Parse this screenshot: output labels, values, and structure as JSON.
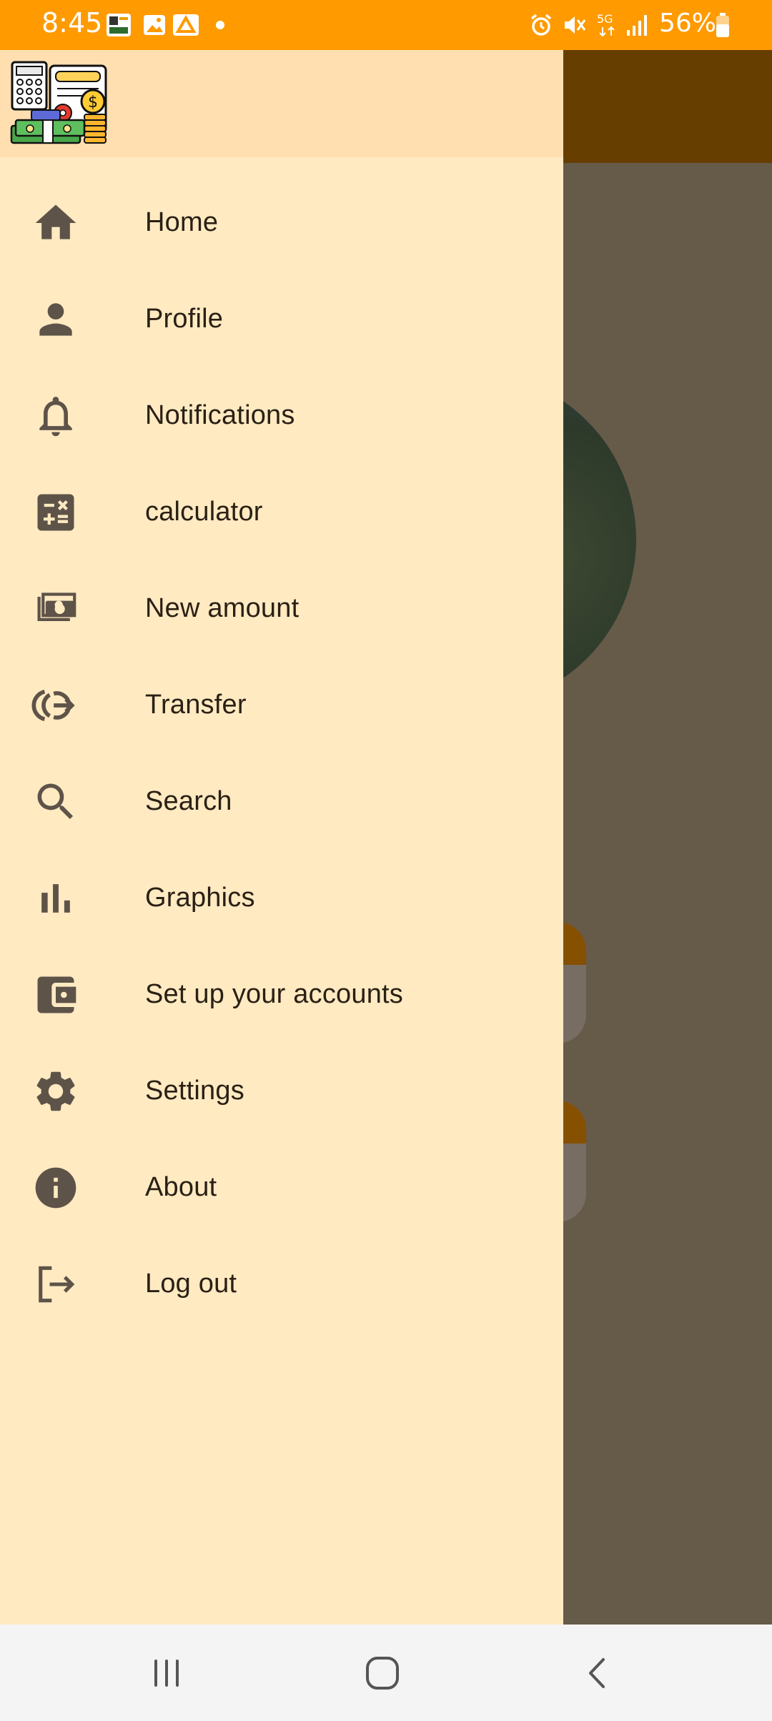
{
  "status_bar": {
    "time": "8:45",
    "battery_percent": "56%",
    "icons": [
      "app-notification-icon",
      "gallery-icon",
      "drive-icon",
      "dot-icon",
      "alarm-icon",
      "mute-icon",
      "5g-icon",
      "signal-icon",
      "battery-icon"
    ]
  },
  "drawer": {
    "menu": [
      {
        "label": "Home",
        "icon": "home-icon"
      },
      {
        "label": "Profile",
        "icon": "person-icon"
      },
      {
        "label": "Notifications",
        "icon": "bell-icon"
      },
      {
        "label": "calculator",
        "icon": "calculator-icon"
      },
      {
        "label": "New amount",
        "icon": "money-icon"
      },
      {
        "label": "Transfer",
        "icon": "transfer-icon"
      },
      {
        "label": "Search",
        "icon": "search-icon"
      },
      {
        "label": "Graphics",
        "icon": "bar-chart-icon"
      },
      {
        "label": "Set up your accounts",
        "icon": "wallet-icon"
      },
      {
        "label": "Settings",
        "icon": "gear-icon"
      },
      {
        "label": "About",
        "icon": "info-icon"
      },
      {
        "label": "Log out",
        "icon": "logout-icon"
      }
    ]
  },
  "colors": {
    "status_bar": "#ff9a00",
    "drawer_bg": "#ffeac2",
    "drawer_header": "#ffdfb0",
    "icon": "#5e5348",
    "text": "#2a2014",
    "scrim": "#665a49"
  },
  "nav_bar": {
    "buttons": [
      "recents-icon",
      "home-nav-icon",
      "back-icon"
    ]
  }
}
